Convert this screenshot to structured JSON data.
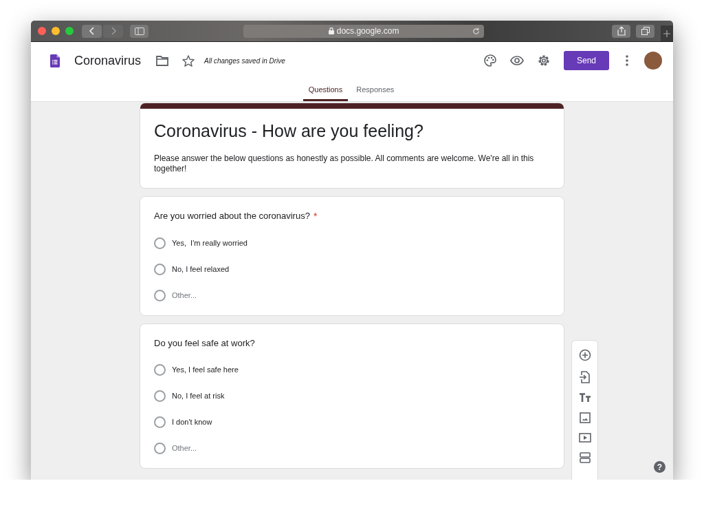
{
  "browser": {
    "address": "docs.google.com"
  },
  "header": {
    "title": "Coronavirus",
    "save_status": "All changes saved in Drive",
    "send_label": "Send"
  },
  "tabs": [
    {
      "label": "Questions",
      "selected": true
    },
    {
      "label": "Responses",
      "selected": false
    }
  ],
  "form": {
    "title": "Coronavirus - How are you feeling?",
    "description": "Please answer the below questions as honestly as possible. All comments are welcome. We're all in this together!"
  },
  "questions": [
    {
      "title": "Are you worried about the coronavirus?",
      "required_mark": "*",
      "options": [
        {
          "label": "Yes,  I'm really worried",
          "kind": "option",
          "selected": false
        },
        {
          "label": "No, I feel relaxed",
          "kind": "option",
          "selected": false
        },
        {
          "label": "Other...",
          "kind": "other",
          "selected": false
        }
      ]
    },
    {
      "title": "Do you feel safe at work?",
      "options": [
        {
          "label": "Yes, I feel safe here",
          "kind": "option",
          "selected": false
        },
        {
          "label": "No, I feel at risk",
          "kind": "option",
          "selected": false
        },
        {
          "label": "I don't know",
          "kind": "option",
          "selected": false
        },
        {
          "label": "Other...",
          "kind": "other",
          "selected": false
        }
      ]
    }
  ],
  "help": {
    "label": "?"
  }
}
